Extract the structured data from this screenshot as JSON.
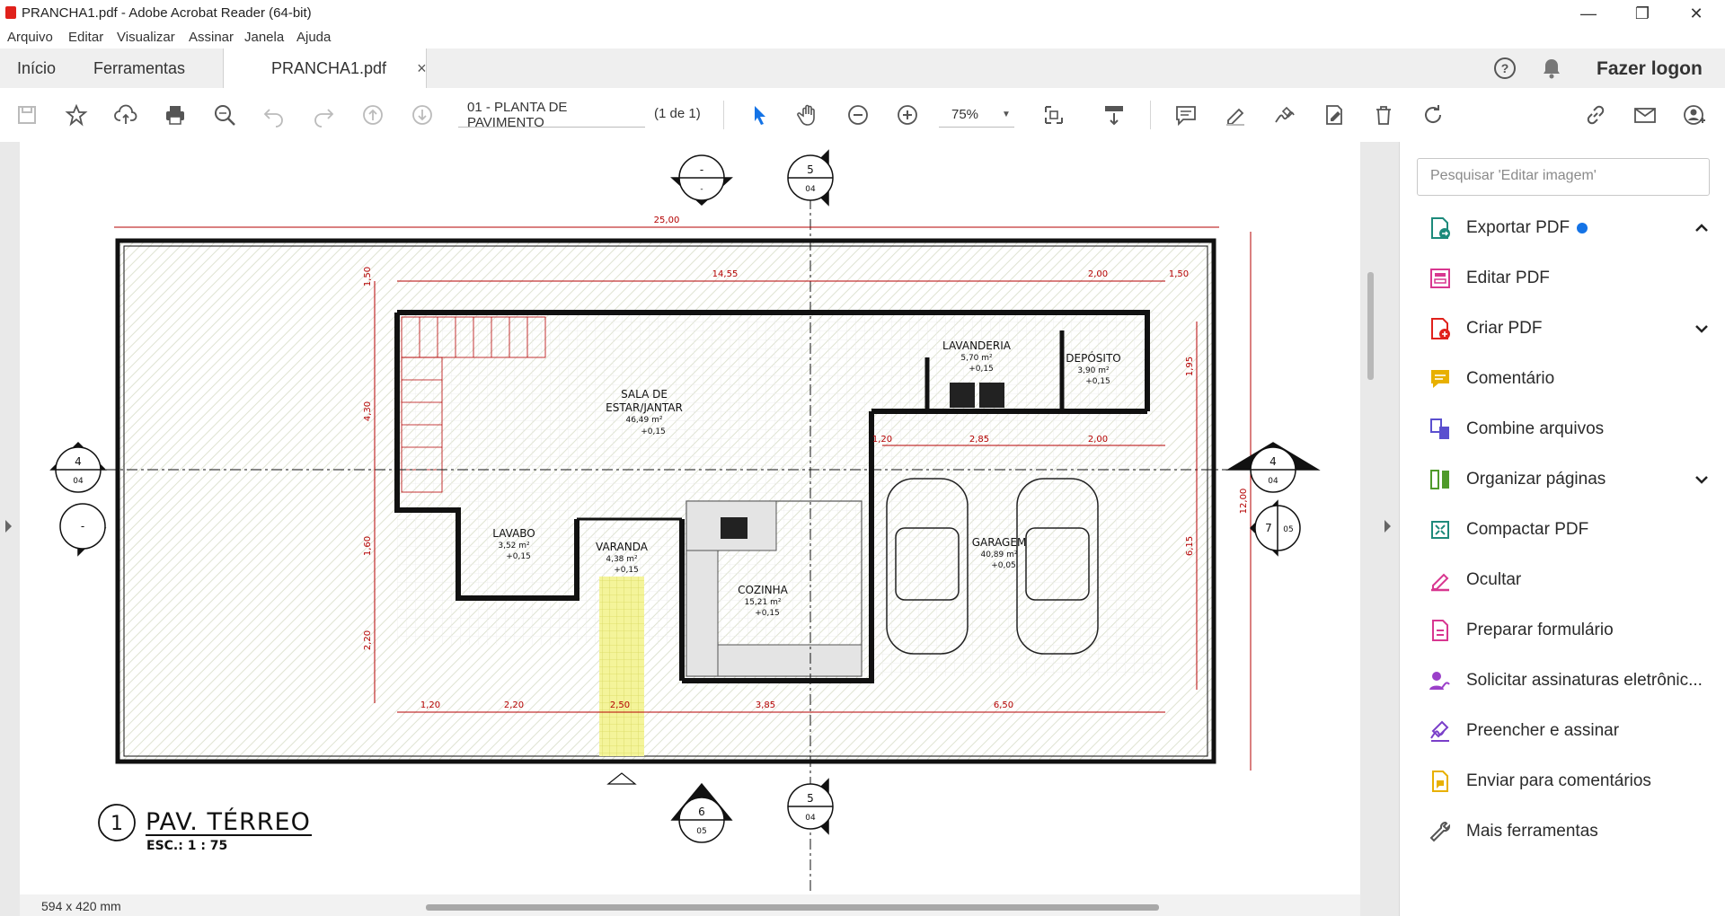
{
  "window": {
    "title": "PRANCHA1.pdf - Adobe Acrobat Reader (64-bit)"
  },
  "menu": [
    "Arquivo",
    "Editar",
    "Visualizar",
    "Assinar",
    "Janela",
    "Ajuda"
  ],
  "tabs": {
    "home": "Início",
    "tools": "Ferramentas",
    "doc": "PRANCHA1.pdf",
    "close": "×"
  },
  "header": {
    "login": "Fazer logon"
  },
  "toolbar": {
    "page_name": "01 - PLANTA DE PAVIMENTO",
    "page_count": "(1 de 1)",
    "zoom": "75%"
  },
  "status": {
    "page_size": "594 x 420 mm"
  },
  "right_panel": {
    "search_placeholder": "Pesquisar 'Editar imagem'",
    "tools": [
      {
        "label": "Exportar PDF",
        "icon": "export-pdf-icon",
        "color": "#1d8a7b"
      },
      {
        "label": "Editar PDF",
        "icon": "edit-pdf-icon",
        "color": "#d83790"
      },
      {
        "label": "Criar PDF",
        "icon": "create-pdf-icon",
        "color": "#e0211b"
      },
      {
        "label": "Comentário",
        "icon": "comment-icon",
        "color": "#e8b000"
      },
      {
        "label": "Combine arquivos",
        "icon": "combine-files-icon",
        "color": "#5a4fcf"
      },
      {
        "label": "Organizar páginas",
        "icon": "organize-pages-icon",
        "color": "#4f9a2a"
      },
      {
        "label": "Compactar PDF",
        "icon": "compress-pdf-icon",
        "color": "#1d8a7b"
      },
      {
        "label": "Ocultar",
        "icon": "redact-icon",
        "color": "#d83790"
      },
      {
        "label": "Preparar formulário",
        "icon": "prepare-form-icon",
        "color": "#d83790"
      },
      {
        "label": "Solicitar assinaturas eletrônic...",
        "icon": "request-signatures-icon",
        "color": "#9b3fc9"
      },
      {
        "label": "Preencher e assinar",
        "icon": "fill-sign-icon",
        "color": "#7a3fc9"
      },
      {
        "label": "Enviar para comentários",
        "icon": "send-for-comments-icon",
        "color": "#e8b000"
      },
      {
        "label": "Mais ferramentas",
        "icon": "more-tools-icon",
        "color": "#555555"
      }
    ]
  },
  "drawing": {
    "title_number": "1",
    "title": "PAV. TÉRREO",
    "scale": "ESC.: 1 : 75",
    "rooms": [
      {
        "name": "SALA DE",
        "name2": "ESTAR/JANTAR",
        "area": "46,49 m²",
        "level": "+0,15"
      },
      {
        "name": "LAVANDERIA",
        "area": "5,70 m²",
        "level": "+0,15"
      },
      {
        "name": "DEPÓSITO",
        "area": "3,90 m²",
        "level": "+0,15"
      },
      {
        "name": "LAVABO",
        "area": "3,52 m²",
        "level": "+0,15"
      },
      {
        "name": "VARANDA",
        "area": "4,38 m²",
        "level": "+0,15"
      },
      {
        "name": "COZINHA",
        "area": "15,21 m²",
        "level": "+0,15"
      },
      {
        "name": "GARAGEM",
        "area": "40,89 m²",
        "level": "+0,05"
      }
    ],
    "dims": {
      "total_width": "25,00",
      "total_height": "12,00",
      "top": [
        "14,55",
        "2,00",
        "1,50"
      ],
      "bottom": [
        "1,20",
        "2,20",
        "2,50",
        "3,85",
        "6,50"
      ],
      "inner": [
        "1,20",
        "2,85",
        "2,00"
      ],
      "left": [
        "1,50",
        "4,30",
        "1,60",
        "2,20"
      ],
      "right": [
        "1,95",
        "6,15"
      ]
    },
    "section_marks": {
      "top_a": "-",
      "top_a_sub": "-",
      "top_b": "5",
      "top_b_sub": "04",
      "left_a": "4",
      "left_a_sub": "04",
      "left_b": "-",
      "left_b_sub": "-",
      "right_a": "4",
      "right_a_sub": "04",
      "right_b": "7",
      "right_b_sub": "05",
      "bottom_a": "6",
      "bottom_a_sub": "05",
      "bottom_b": "5",
      "bottom_b_sub": "04"
    }
  }
}
